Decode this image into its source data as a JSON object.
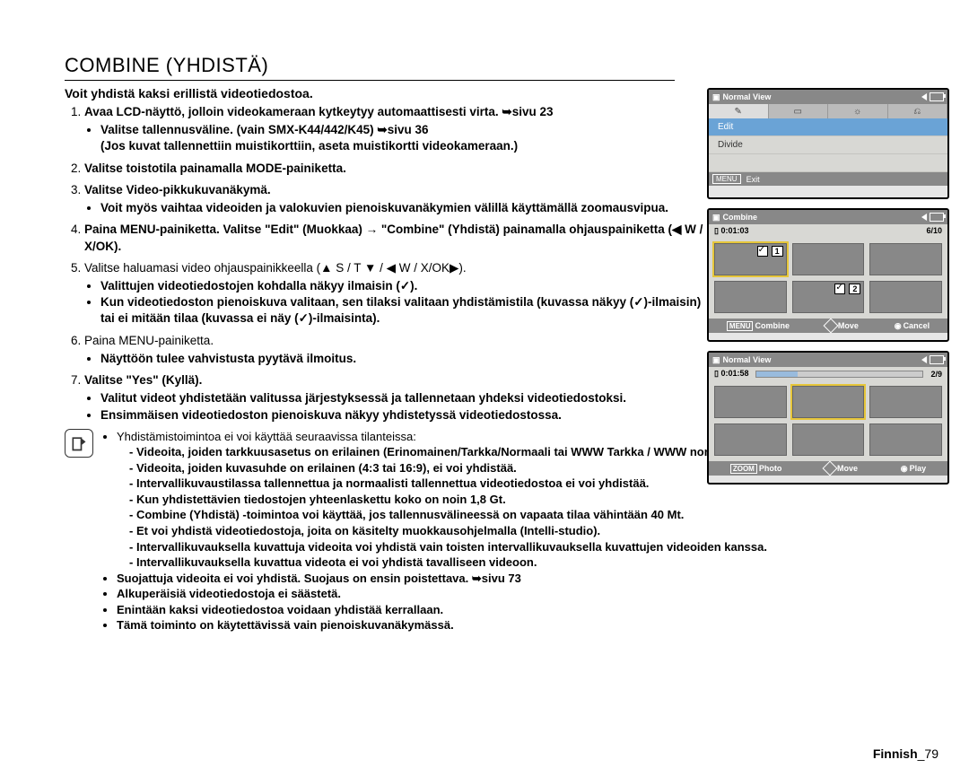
{
  "title": "COMBINE (YHDISTÄ)",
  "intro": "Voit yhdistä kaksi erillistä videotiedostoa.",
  "steps": [
    {
      "text": "Avaa LCD-näyttö, jolloin videokameraan kytkeytyy automaattisesti virta. ➥sivu 23",
      "bold_mixed": true,
      "subs": [
        {
          "html": "Valitse tallennusväline. (vain SMX-K44/442/K45) ➥sivu 36",
          "bold": true
        },
        {
          "html": "(Jos kuvat tallennettiin muistikorttiin, aseta muistikortti videokameraan.)",
          "bold": true,
          "cont": true
        }
      ]
    },
    {
      "text": "Valitse toistotila painamalla MODE-painiketta.",
      "bold": true
    },
    {
      "text": "Valitse Video-pikkukuvanäkymä.",
      "bold": true,
      "subs": [
        {
          "html": "Voit myös vaihtaa videoiden ja valokuvien pienoiskuvanäkymien välillä käyttämällä zoomausvipua.",
          "bold": true
        }
      ]
    },
    {
      "text": "Paina MENU-painiketta. Valitse \"Edit\" (Muokkaa) → \"Combine\" (Yhdistä) painamalla ohjauspainiketta (◀ W / X/OK).",
      "bold": true
    },
    {
      "text": "Valitse haluamasi video ohjauspainikkeella (▲ S / T ▼ / ◀ W / X/OK▶).",
      "subs": [
        {
          "html": "Valittujen videotiedostojen kohdalla näkyy ilmaisin (✓).",
          "bold": true
        },
        {
          "html": "Kun videotiedoston pienoiskuva valitaan, sen tilaksi valitaan yhdistämistila (kuvassa näkyy (✓)-ilmaisin) tai ei mitään tilaa (kuvassa ei näy (✓)-ilmaisinta).",
          "bold": true
        }
      ]
    },
    {
      "text": "Paina MENU-painiketta.",
      "subs": [
        {
          "html": "Näyttöön tulee vahvistusta pyytävä ilmoitus.",
          "bold": true
        }
      ]
    },
    {
      "text": "Valitse \"Yes\" (Kyllä).",
      "bold": true,
      "subs": [
        {
          "html": "Valitut videot yhdistetään valitussa järjestyksessä ja tallennetaan yhdeksi videotiedostoksi.",
          "bold": true
        },
        {
          "html": "Ensimmäisen videotiedoston pienoiskuva näkyy yhdistetyssä videotiedostossa.",
          "bold": true
        }
      ]
    }
  ],
  "notes": {
    "lead": "Yhdistämistoimintoa ei voi käyttää seuraavissa tilanteissa:",
    "dashes": [
      "Videoita, joiden tarkkuusasetus on erilainen (Erinomainen/Tarkka/Normaali tai WWW Tarkka / WWW normaali), ei voi yhdistää.",
      "Videoita, joiden kuvasuhde on erilainen (4:3 tai 16:9), ei voi yhdistää.",
      "Intervallikuvaustilassa tallennettua ja normaalisti tallennettua videotiedostoa ei voi yhdistää.",
      "Kun yhdistettävien tiedostojen yhteenlaskettu koko on noin 1,8 Gt.",
      "Combine (Yhdistä) -toimintoa voi käyttää, jos tallennusvälineessä on vapaata tilaa vähintään 40 Mt.",
      "Et voi yhdistä videotiedostoja, joita on käsitelty muokkausohjelmalla (Intelli-studio).",
      "Intervallikuvauksella kuvattuja videoita voi yhdistä vain toisten intervallikuvauksella kuvattujen videoiden kanssa.",
      "Intervallikuvauksella kuvattua videota ei voi yhdistä tavalliseen videoon."
    ],
    "bullets": [
      "Suojattuja videoita ei voi yhdistä. Suojaus on ensin poistettava. ➥sivu 73",
      "Alkuperäisiä videotiedostoja ei säästetä.",
      "Enintään kaksi videotiedostoa voidaan yhdistää kerrallaan.",
      "Tämä toiminto on käytettävissä vain pienoiskuvanäkymässä."
    ]
  },
  "footer": {
    "lang": "Finnish",
    "page": "79"
  },
  "screens": {
    "s1": {
      "title": "Normal View",
      "tabs_icon": "✎",
      "edit": "Edit",
      "divide": "Divide",
      "menu": "MENU",
      "exit": "Exit"
    },
    "s2": {
      "title": "Combine",
      "time": "0:01:03",
      "counter": "6/10",
      "num1": "1",
      "num2": "2",
      "menu": "MENU",
      "combine": "Combine",
      "move": "Move",
      "cancel": "Cancel"
    },
    "s3": {
      "title": "Normal View",
      "time": "0:01:58",
      "counter": "2/9",
      "zoom": "ZOOM",
      "photo": "Photo",
      "move": "Move",
      "play": "Play"
    }
  }
}
